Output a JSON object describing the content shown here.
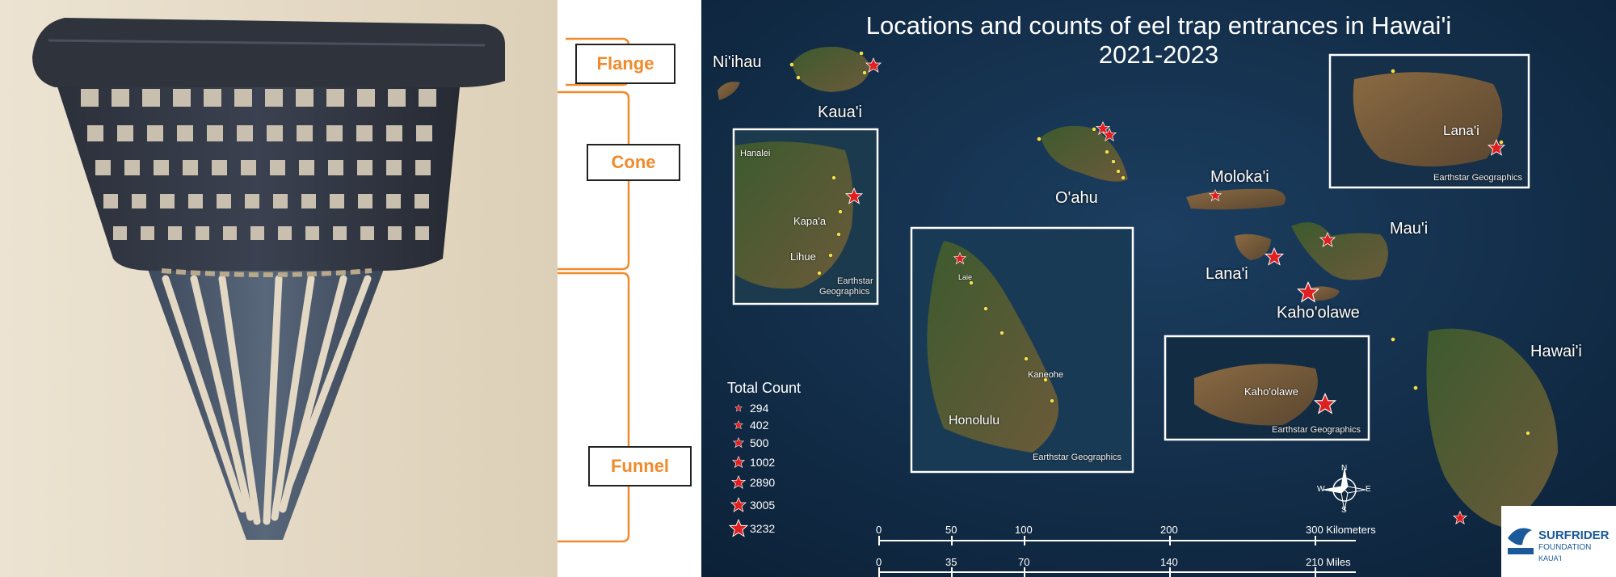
{
  "labels": {
    "flange": "Flange",
    "cone": "Cone",
    "funnel": "Funnel"
  },
  "map": {
    "title_line1": "Locations and counts of eel trap entrances in Hawai'i",
    "title_line2": "2021-2023",
    "islands": {
      "niihau": "Ni'ihau",
      "kauai": "Kaua'i",
      "oahu": "O'ahu",
      "molokai": "Moloka'i",
      "lanai": "Lana'i",
      "maui": "Mau'i",
      "kahoolawe": "Kaho'olawe",
      "hawaii": "Hawai'i"
    },
    "insets": {
      "kauai": {
        "hanalei": "Hanalei",
        "kapaa": "Kapa'a",
        "lihue": "Lihue",
        "credit1": "Earthstar",
        "credit2": "Geographics"
      },
      "oahu": {
        "laie": "Laie",
        "kaneohe": "Kaneohe",
        "honolulu": "Honolulu",
        "credit": "Earthstar Geographics"
      },
      "lanai": {
        "name": "Lana'i",
        "credit": "Earthstar Geographics"
      },
      "kahoolawe": {
        "name": "Kaho'olawe",
        "credit": "Earthstar Geographics"
      }
    },
    "legend": {
      "title": "Total Count",
      "items": [
        "294",
        "402",
        "500",
        "1002",
        "2890",
        "3005",
        "3232"
      ]
    },
    "scale": {
      "km_ticks": [
        "0",
        "50",
        "100",
        "200",
        "300 Kilometers"
      ],
      "mi_ticks": [
        "0",
        "35",
        "70",
        "140",
        "210 Miles"
      ]
    },
    "compass": {
      "n": "N",
      "s": "S",
      "e": "E",
      "w": "W"
    },
    "logo": {
      "line1": "SURFRIDER",
      "line2": "FOUNDATION",
      "line3": "KAUA'I"
    },
    "colors": {
      "ocean": "#0f2a44",
      "star": "#e02020",
      "dot": "#f2e24a",
      "label_orange": "#f08a2c"
    }
  }
}
